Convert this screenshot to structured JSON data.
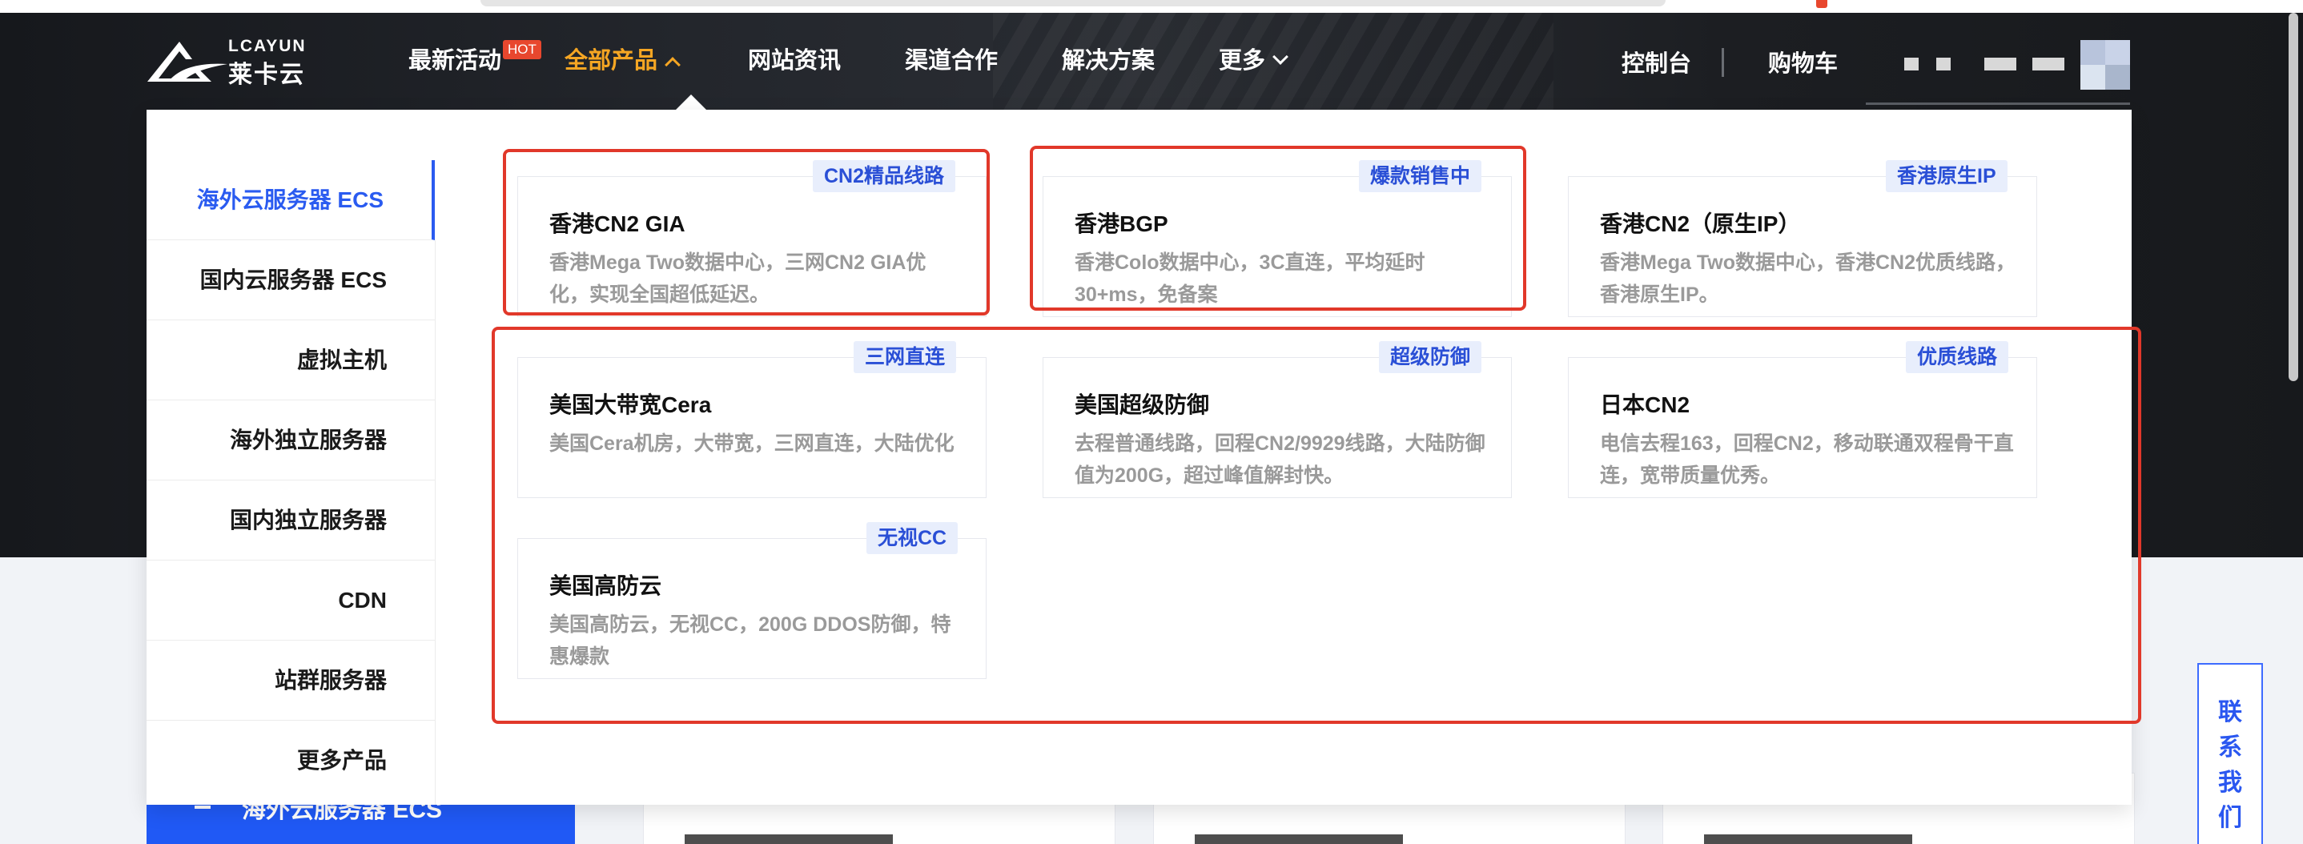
{
  "logo": {
    "text_en": "LCAYUN",
    "text_cn": "莱卡云",
    "registered": "®"
  },
  "nav": {
    "items": [
      {
        "label": "最新活动"
      },
      {
        "label": "全部产品"
      },
      {
        "label": "网站资讯"
      },
      {
        "label": "渠道合作"
      },
      {
        "label": "解决方案"
      },
      {
        "label": "更多"
      }
    ],
    "hot_badge": "HOT",
    "console": "控制台",
    "cart": "购物车"
  },
  "colors": {
    "accent": "#f5a623",
    "brand_blue": "#2a5bf0",
    "highlight_red": "#e1382a",
    "hot": "#e8472e"
  },
  "sidebar": {
    "items": [
      {
        "label": "海外云服务器 ECS"
      },
      {
        "label": "国内云服务器 ECS"
      },
      {
        "label": "虚拟主机"
      },
      {
        "label": "海外独立服务器"
      },
      {
        "label": "国内独立服务器"
      },
      {
        "label": "CDN"
      },
      {
        "label": "站群服务器"
      },
      {
        "label": "更多产品"
      }
    ]
  },
  "products": [
    {
      "tag": "CN2精品线路",
      "title": "香港CN2 GIA",
      "desc": "香港Mega Two数据中心，三网CN2 GIA优化，实现全国超低延迟。"
    },
    {
      "tag": "爆款销售中",
      "title": "香港BGP",
      "desc": "香港Colo数据中心，3C直连，平均延时30+ms，免备案"
    },
    {
      "tag": "香港原生IP",
      "title": "香港CN2（原生IP）",
      "desc": "香港Mega Two数据中心，香港CN2优质线路，香港原生IP。"
    },
    {
      "tag": "三网直连",
      "title": "美国大带宽Cera",
      "desc": "美国Cera机房，大带宽，三网直连，大陆优化"
    },
    {
      "tag": "超级防御",
      "title": "美国超级防御",
      "desc": "去程普通线路，回程CN2/9929线路，大陆防御值为200G，超过峰值解封快。"
    },
    {
      "tag": "优质线路",
      "title": "日本CN2",
      "desc": "电信去程163，回程CN2，移动联通双程骨干直连，宽带质量优秀。"
    },
    {
      "tag": "无视CC",
      "title": "美国高防云",
      "desc": "美国高防云，无视CC，200G DDOS防御，特惠爆款"
    }
  ],
  "background_page": {
    "side_tab": "海外云服务器 ECS",
    "contact": "联系我们"
  }
}
